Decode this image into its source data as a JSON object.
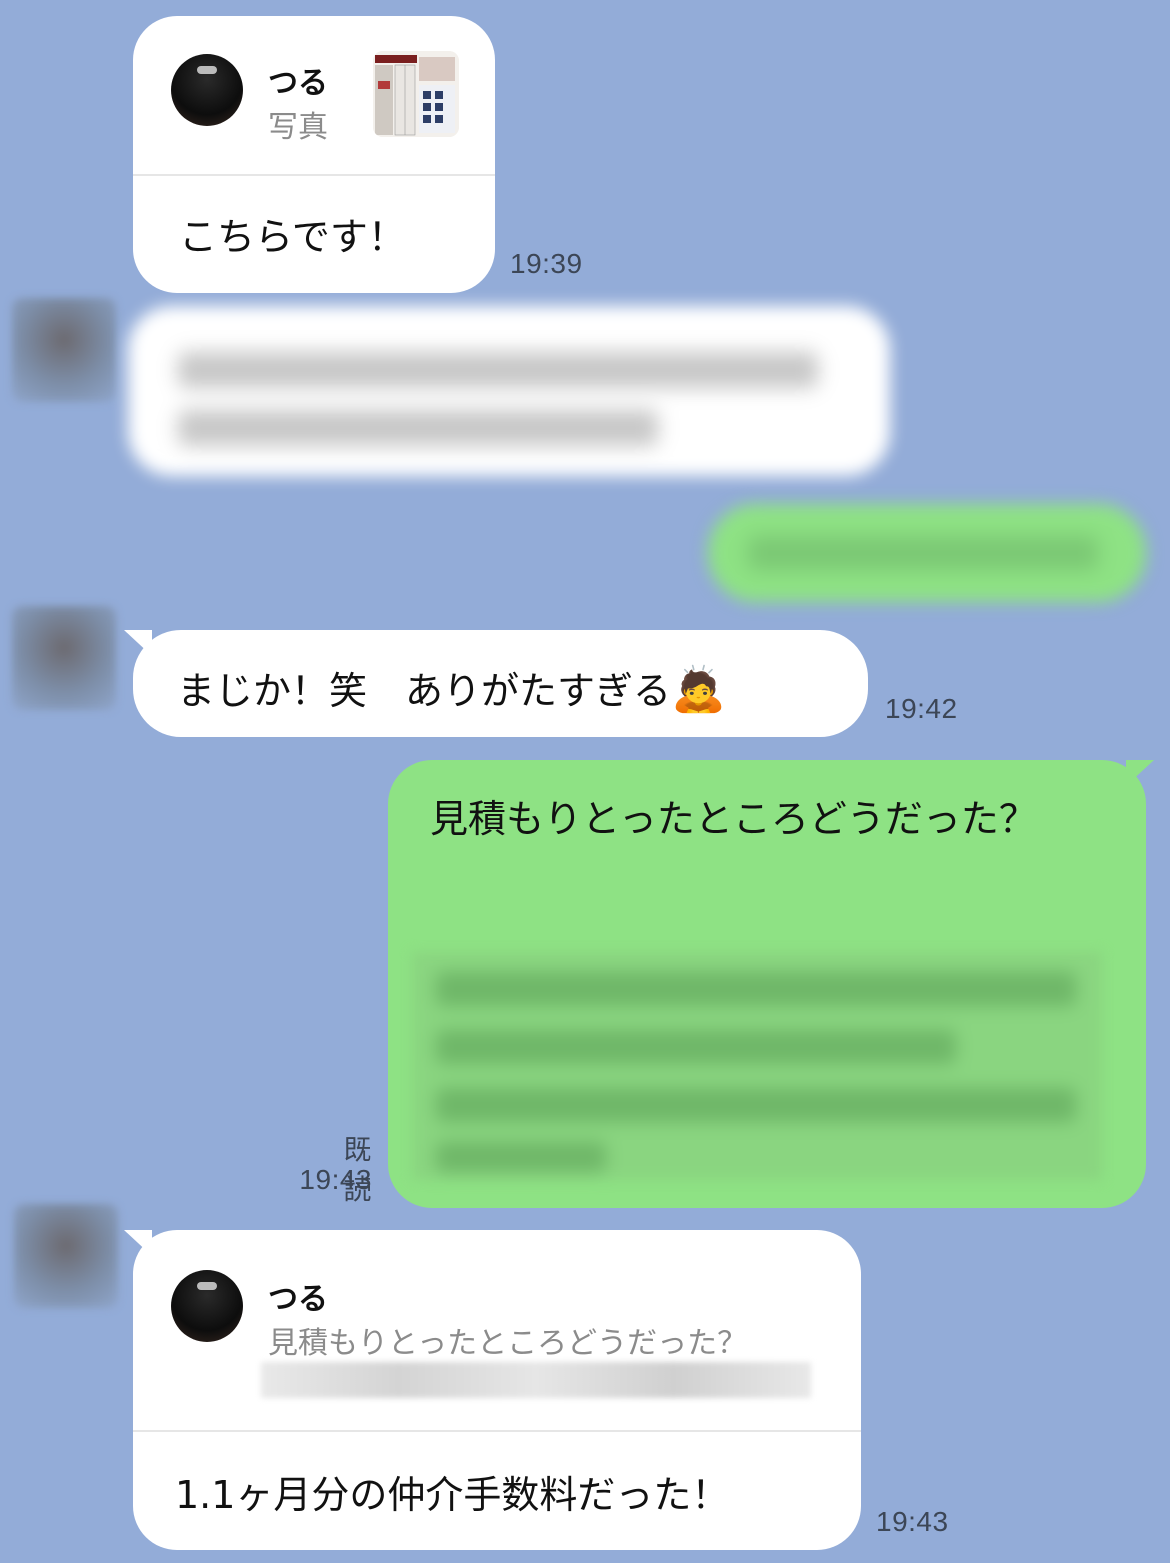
{
  "messages": {
    "m1": {
      "reply_name": "つる",
      "reply_type": "写真",
      "text": "こちらです！",
      "time": "19:39"
    },
    "m3": {
      "text": "まじか！笑　ありがたすぎる",
      "emoji": "🙇",
      "time": "19:42"
    },
    "m4": {
      "text": "見積もりとったところどうだった？",
      "read": "既読",
      "time": "19:43"
    },
    "m5": {
      "reply_name": "つる",
      "reply_text": "見積もりとったところどうだった？",
      "text": "1.1ヶ月分の仲介手数料だった！",
      "time": "19:43"
    }
  },
  "icons": [
    "avatar",
    "photo-thumbnail",
    "person-bowing-emoji"
  ],
  "colors": {
    "background": "#93acd8",
    "incoming_bubble": "#ffffff",
    "outgoing_bubble": "#8ee284"
  }
}
